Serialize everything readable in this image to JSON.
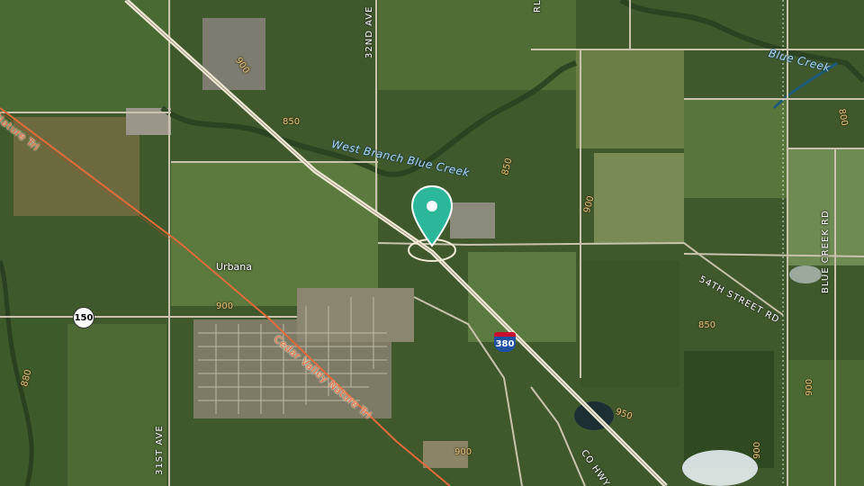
{
  "map": {
    "type": "satellite",
    "marker": {
      "name": "location-pin-icon",
      "color": "#2bb89a"
    },
    "places": [
      {
        "key": "urbana",
        "label": "Urbana"
      }
    ],
    "waterways": [
      {
        "key": "west-branch",
        "label": "West Branch Blue Creek"
      },
      {
        "key": "blue-creek",
        "label": "Blue Creek"
      }
    ],
    "roads": [
      {
        "key": "32nd-ave",
        "label": "32ND AVE"
      },
      {
        "key": "31st-ave",
        "label": "31ST AVE"
      },
      {
        "key": "blue-creek-rd",
        "label": "BLUE CREEK RD"
      },
      {
        "key": "54th-st",
        "label": "54TH STREET RD"
      },
      {
        "key": "co-hwy",
        "label": "CO HWY"
      },
      {
        "key": "rl",
        "label": "RL"
      }
    ],
    "trails": [
      {
        "key": "cvnt-main",
        "label": "Cedar Valley Nature Trl"
      },
      {
        "key": "cvnt-upper",
        "label": "Nature Trl"
      }
    ],
    "shields": [
      {
        "key": "us150",
        "label": "150"
      },
      {
        "key": "i380",
        "label": "380"
      }
    ],
    "elevations": [
      "900",
      "850",
      "850",
      "900",
      "900",
      "850",
      "800",
      "880",
      "950",
      "900",
      "900",
      "900",
      "800",
      "850"
    ]
  }
}
